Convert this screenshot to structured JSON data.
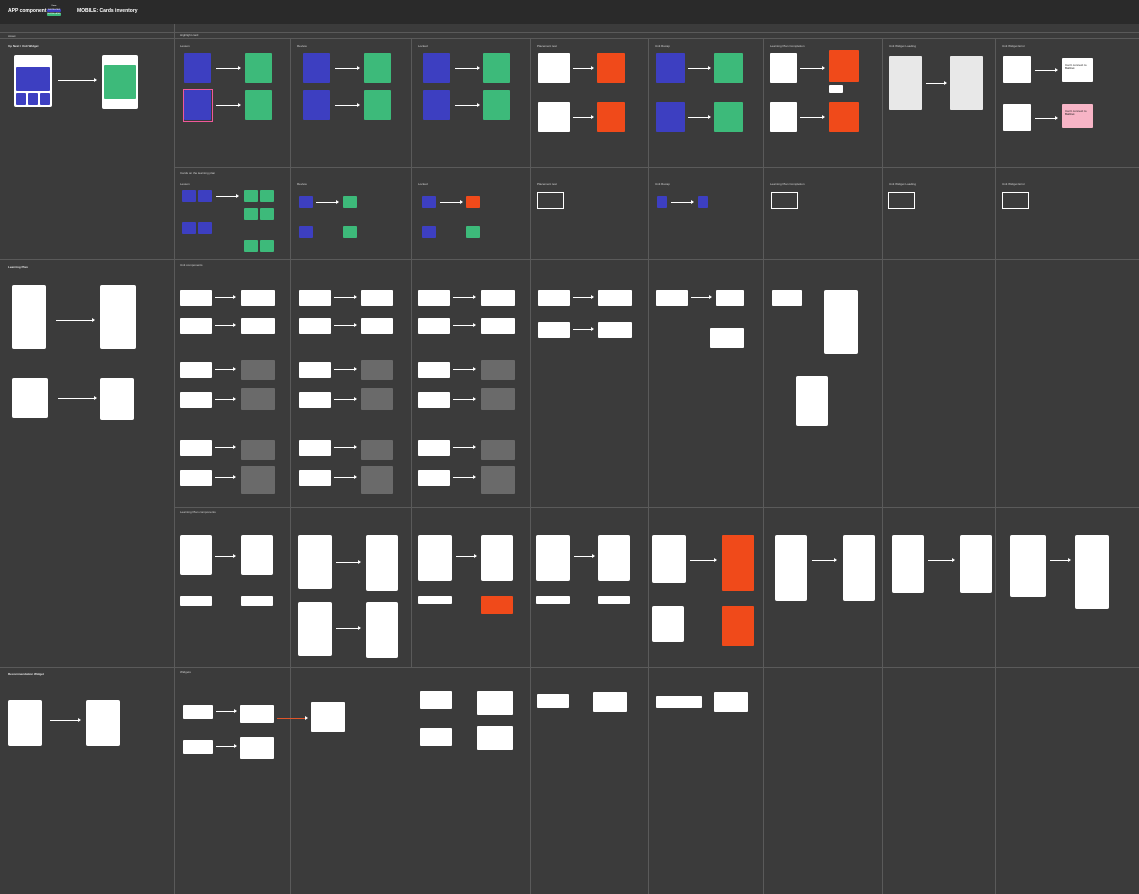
{
  "header": {
    "app_title": "APP component",
    "page_title": "MOBILE: Cards inventory",
    "tags": [
      {
        "label": "Done",
        "color": "#2a2a2a"
      },
      {
        "label": "WIP/REVIEW",
        "color": "#3d3fc1"
      },
      {
        "label": "DEPRECATED",
        "color": "#3dba7a"
      }
    ]
  },
  "sections": {
    "legend": "Asset",
    "up_next": "Up Next / Unit Widget",
    "learning_plan": "Learning Plan",
    "recommendation": "Recommendation Widget",
    "highlight_card": "Highlight card",
    "cards_on_learning_plan": "Cards on the learning plan",
    "unit_components": "Unit components",
    "learning_plan_components": "Learning Plan components",
    "widgets": "Widgets"
  },
  "column_labels": {
    "lesson": "Lesson",
    "review": "Review",
    "locked": "Locked",
    "placement_test": "Placement test",
    "unit_recap": "Unit Recap",
    "learning_plan_completion": "Learning Plan Completion",
    "unit_widget_loading": "Unit Widget Loading",
    "unit_widget_error": "Unit Widget Error"
  },
  "error_card": {
    "message": "Can't connect to Babbel."
  }
}
